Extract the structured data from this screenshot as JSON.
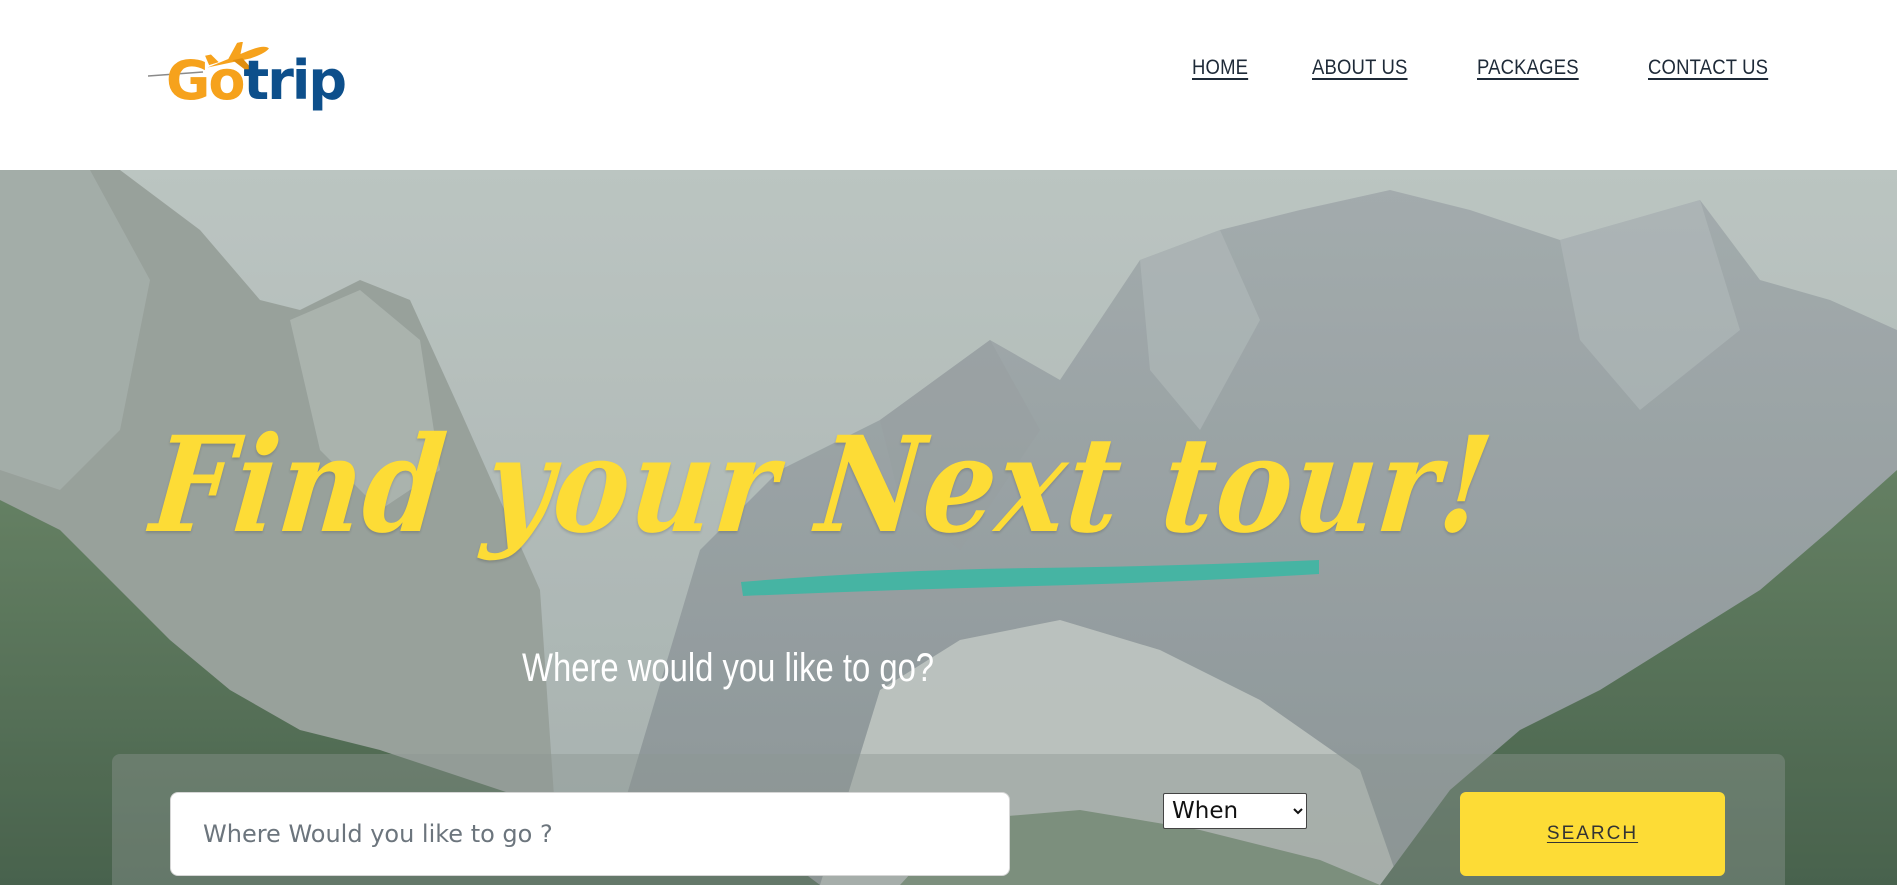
{
  "header": {
    "logo": {
      "part1": "Go",
      "part2": "trip",
      "icon": "airplane-icon"
    },
    "nav": [
      {
        "label": "HOME"
      },
      {
        "label": "ABOUT US"
      },
      {
        "label": "PACKAGES"
      },
      {
        "label": "CONTACT US"
      }
    ]
  },
  "hero": {
    "headline": "Find your Next tour!",
    "subheading": "Where would you like to go?",
    "search": {
      "placeholder": "Where Would you like to go ?",
      "value": "",
      "when_selected": "When",
      "button_label": "SEARCH"
    }
  },
  "colors": {
    "accent_yellow": "#fddc36",
    "underline_teal": "#3fb5a3",
    "logo_orange": "#f6a21c",
    "logo_blue": "#0d4f8b",
    "nav_text": "#1e2a38"
  }
}
